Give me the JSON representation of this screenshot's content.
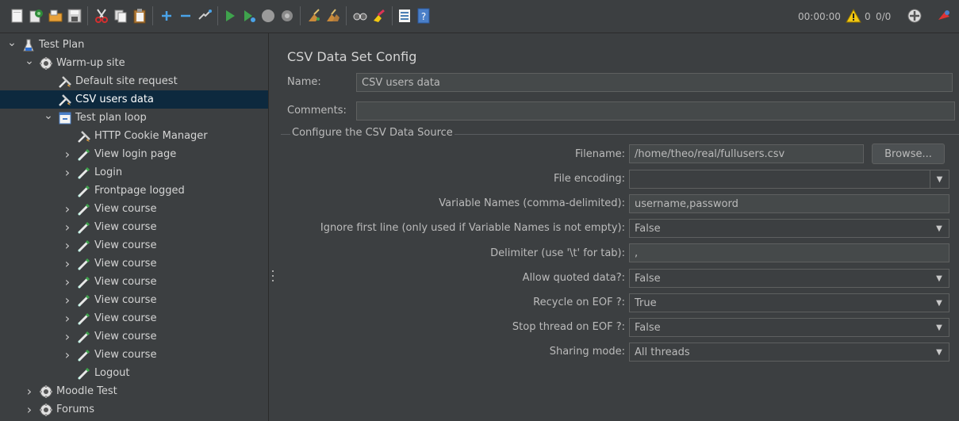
{
  "toolbar": {
    "icons": [
      "new-icon",
      "templates-icon",
      "open-icon",
      "save-icon",
      "cut-icon",
      "copy-icon",
      "paste-icon",
      "expand-icon",
      "collapse-icon",
      "toggle-icon",
      "start-icon",
      "start-no-pauses-icon",
      "stop-icon",
      "shutdown-icon",
      "clear-icon",
      "clear-all-icon",
      "search-icon",
      "reset-search-icon",
      "function-helper-icon",
      "help-icon"
    ],
    "timer": "00:00:00",
    "warning_count": "0",
    "threads": "0/0"
  },
  "tree": {
    "items": [
      {
        "label": "Test Plan",
        "icon": "flask-icon",
        "expander": "open"
      },
      {
        "label": "Warm-up site",
        "icon": "thread-group-gear-icon",
        "expander": "open"
      },
      {
        "label": "Default site request",
        "icon": "config-wrench-icon",
        "expander": "none"
      },
      {
        "label": "CSV users data",
        "icon": "config-wrench-icon",
        "expander": "none",
        "selected": true
      },
      {
        "label": "Test plan loop",
        "icon": "loop-controller-icon",
        "expander": "open"
      },
      {
        "label": "HTTP Cookie Manager",
        "icon": "config-wrench-icon",
        "expander": "none"
      },
      {
        "label": "View login page",
        "icon": "sampler-pipette-icon",
        "expander": "closed"
      },
      {
        "label": "Login",
        "icon": "sampler-pipette-icon",
        "expander": "closed"
      },
      {
        "label": "Frontpage logged",
        "icon": "sampler-pipette-icon",
        "expander": "none"
      },
      {
        "label": "View course",
        "icon": "sampler-pipette-icon",
        "expander": "closed"
      },
      {
        "label": "View course",
        "icon": "sampler-pipette-icon",
        "expander": "closed"
      },
      {
        "label": "View course",
        "icon": "sampler-pipette-icon",
        "expander": "closed"
      },
      {
        "label": "View course",
        "icon": "sampler-pipette-icon",
        "expander": "closed"
      },
      {
        "label": "View course",
        "icon": "sampler-pipette-icon",
        "expander": "closed"
      },
      {
        "label": "View course",
        "icon": "sampler-pipette-icon",
        "expander": "closed"
      },
      {
        "label": "View course",
        "icon": "sampler-pipette-icon",
        "expander": "closed"
      },
      {
        "label": "View course",
        "icon": "sampler-pipette-icon",
        "expander": "closed"
      },
      {
        "label": "View course",
        "icon": "sampler-pipette-icon",
        "expander": "closed"
      },
      {
        "label": "Logout",
        "icon": "sampler-pipette-icon",
        "expander": "none"
      },
      {
        "label": "Moodle Test",
        "icon": "thread-group-gear-icon",
        "expander": "closed"
      },
      {
        "label": "Forums",
        "icon": "thread-group-gear-icon",
        "expander": "closed"
      }
    ]
  },
  "panel": {
    "title": "CSV Data Set Config",
    "name_label": "Name:",
    "name_value": "CSV users data",
    "comments_label": "Comments:",
    "comments_value": "",
    "group_title": "Configure the CSV Data Source",
    "filename_label": "Filename:",
    "filename_value": "/home/theo/real/fullusers.csv",
    "browse_label": "Browse...",
    "encoding_label": "File encoding:",
    "encoding_value": "",
    "varnames_label": "Variable Names (comma-delimited):",
    "varnames_value": "username,password",
    "ignore_label": "Ignore first line (only used if Variable Names is not empty):",
    "ignore_value": "False",
    "delimiter_label": "Delimiter (use '\\t' for tab):",
    "delimiter_value": ",",
    "quoted_label": "Allow quoted data?:",
    "quoted_value": "False",
    "recycle_label": "Recycle on EOF ?:",
    "recycle_value": "True",
    "stopthread_label": "Stop thread on EOF ?:",
    "stopthread_value": "False",
    "sharing_label": "Sharing mode:",
    "sharing_value": "All threads"
  },
  "colors": {
    "background": "#3c3f41",
    "selection": "#0d293e",
    "field": "#45494a",
    "run_green": "#3fa34d",
    "warning_yellow": "#f2c811"
  }
}
